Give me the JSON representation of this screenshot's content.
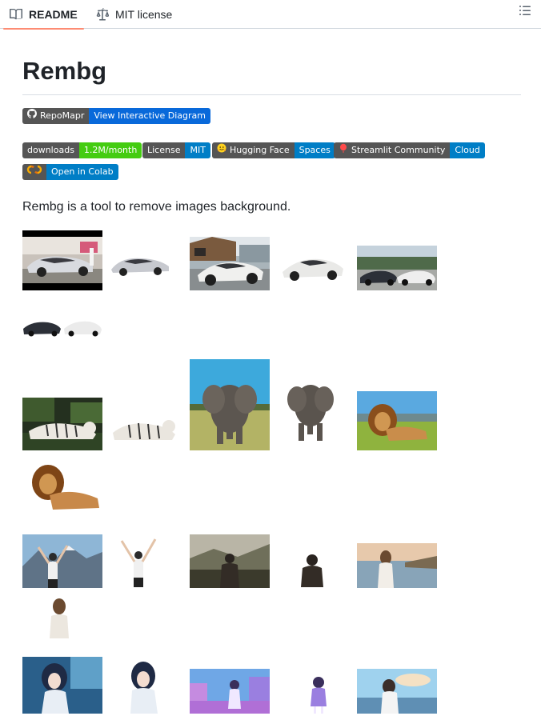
{
  "tabs": {
    "readme_label": "README",
    "license_label": "MIT license"
  },
  "title": "Rembg",
  "badges": {
    "repomapr": {
      "left": "RepoMapr",
      "right": "View Interactive Diagram",
      "right_color": "#0969da"
    },
    "downloads": {
      "left": "downloads",
      "right": "1.2M/month",
      "right_color": "#4c1"
    },
    "license": {
      "left": "License",
      "right": "MIT",
      "right_color": "#007ec6"
    },
    "huggingface": {
      "left": "Hugging Face",
      "right": "Spaces",
      "right_color": "#007ec6"
    },
    "streamlit": {
      "left": "Streamlit Community",
      "right": "Cloud",
      "right_color": "#007ec6"
    },
    "colab": {
      "left": "",
      "right": "Open in Colab",
      "right_color": "#007ec6"
    }
  },
  "intro_text": "Rembg is a tool to remove images background.",
  "icons": {
    "readme": "book-icon",
    "license": "law-scale-icon",
    "toc": "list-icon"
  }
}
